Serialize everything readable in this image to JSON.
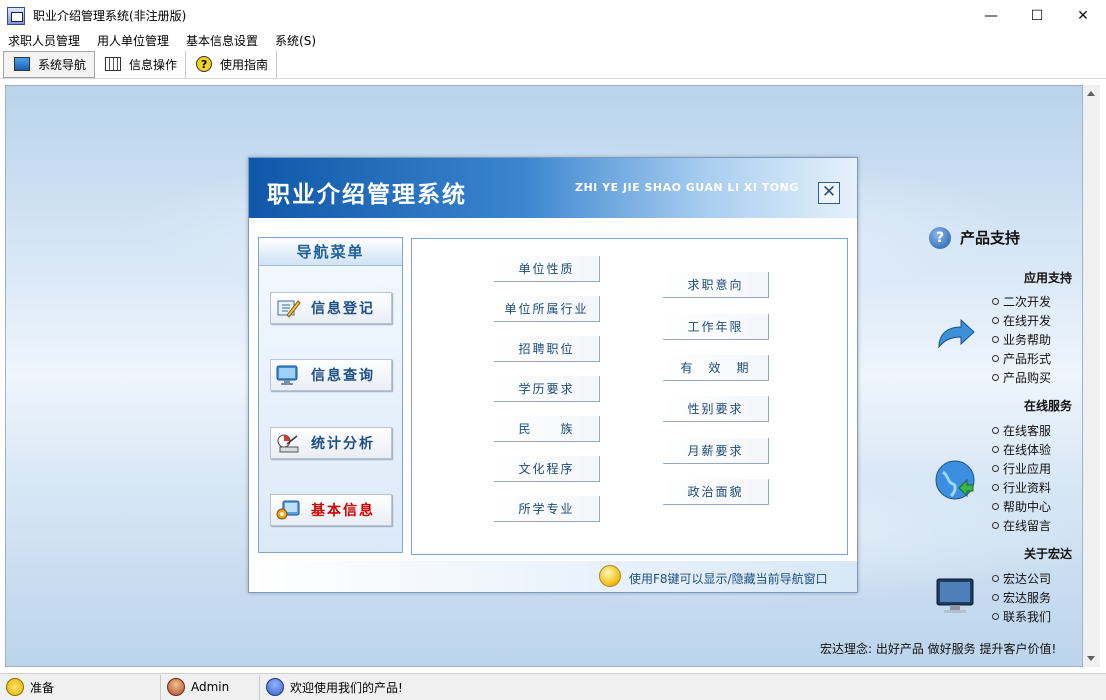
{
  "window": {
    "title": "职业介绍管理系统(非注册版)",
    "controls": {
      "minimize": "—",
      "maximize": "☐",
      "close": "✕"
    }
  },
  "menu": [
    "求职人员管理",
    "用人单位管理",
    "基本信息设置",
    "系统(S)"
  ],
  "toolbar": {
    "nav": "系统导航",
    "info_ops": "信息操作",
    "guide": "使用指南"
  },
  "dialog": {
    "title": "职业介绍管理系统",
    "pinyin": "ZHI YE JIE SHAO GUAN LI XI TONG",
    "close": "✕",
    "nav_heading": "导航菜单",
    "nav_items": [
      "信息登记",
      "信息查询",
      "统计分析",
      "基本信息"
    ],
    "left_options": [
      "单位性质",
      "单位所属行业",
      "招聘职位",
      "学历要求",
      "民　　族",
      "文化程序",
      "所学专业"
    ],
    "right_options": [
      "求职意向",
      "工作年限",
      "有　效　期",
      "性别要求",
      "月薪要求",
      "政治面貌"
    ],
    "footer_tip": "使用F8键可以显示/隐藏当前导航窗口"
  },
  "support": {
    "title": "产品支持",
    "sections": [
      {
        "heading": "应用支持",
        "links": [
          "二次开发",
          "在线开发",
          "业务帮助",
          "产品形式",
          "产品购买"
        ]
      },
      {
        "heading": "在线服务",
        "links": [
          "在线客服",
          "在线体验",
          "行业应用",
          "行业资料",
          "帮助中心",
          "在线留言"
        ]
      },
      {
        "heading": "关于宏达",
        "links": [
          "宏达公司",
          "宏达服务",
          "联系我们"
        ]
      }
    ],
    "slogan": "宏达理念: 出好产品 做好服务 提升客户价值!"
  },
  "status": {
    "ready": "准备",
    "user": "Admin",
    "welcome": "欢迎使用我们的产品!"
  },
  "colors": {
    "header_blue": "#0f57a8",
    "nav_text": "#1d4f84",
    "nav_highlight": "#d00000"
  }
}
